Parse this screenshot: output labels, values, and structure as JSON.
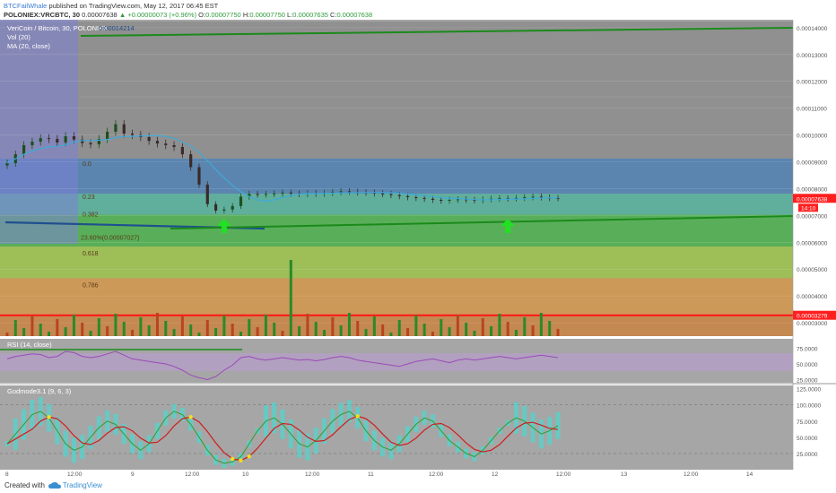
{
  "header": {
    "author": "BTCFailWhale",
    "published": "published on TradingView.com, May 12, 2017 06:45 EST",
    "symbol": "POLONIEX:VRCBTC, 30",
    "last": "0.00007638",
    "change": "▲ +0.00000073 (+0.96%)",
    "o_label": "O:",
    "o_value": "0.00007750",
    "h_label": "H:",
    "h_value": "0.00007750",
    "l_label": "L:",
    "l_value": "0.00007635",
    "c_label": "C:",
    "c_value": "0.00007638"
  },
  "footer": {
    "created_with": "Created with",
    "brand": "TradingView"
  },
  "colors": {
    "price_box": "#ff1f1f",
    "support_line": "#1b8a1b",
    "arrow": "#22e022",
    "rsi_line": "#9b4ab8",
    "godmode_red": "#cc1f1f",
    "godmode_green": "#2f9e2f",
    "godmode_cyan": "#4dd8d0",
    "godmode_yellow": "#f0e020"
  },
  "chart_data": [
    {
      "type": "candlestick",
      "legend": [
        "VeriCoin / Bitcoin, 30, POLONIEX",
        "Vol (20)",
        "MA (20, close)"
      ],
      "series_label": "0.00014214",
      "y_axis": [
        "0.00014000",
        "0.00013000",
        "0.00012000",
        "0.00011000",
        "0.00010000",
        "0.00009000",
        "0.00008000",
        "0.00007000",
        "0.00006000",
        "0.00005000",
        "0.00004000",
        "0.00003000"
      ],
      "ylim": [
        2.5e-05,
        0.0001423
      ],
      "current_price": {
        "value": "0.00007638",
        "time_left": "14:10"
      },
      "support_level": {
        "value": "0.00003279",
        "y": 3.279e-05
      },
      "fib_labels": [
        "0.0",
        "0.23",
        "0.382",
        "23.60%(0.00007027)",
        "0.618",
        "0.786"
      ],
      "fib_levels_price": [
        0.0001423,
        9.12e-05,
        7.81e-05,
        7.027e-05,
        5.84e-05,
        4.66e-05,
        3.279e-05
      ],
      "x_labels": [
        "8",
        "12:00",
        "9",
        "12:00",
        "10",
        "12:00",
        "11",
        "12:00",
        "12",
        "12:00",
        "13",
        "12:00",
        "14"
      ],
      "price_close": [
        8.95e-05,
        9.28e-05,
        9.62e-05,
        9.75e-05,
        9.88e-05,
        9.85e-05,
        9.72e-05,
        9.95e-05,
        9.83e-05,
        9.7e-05,
        9.65e-05,
        9.85e-05,
        0.0001012,
        0.000104,
        0.0001005,
        0.0001,
        9.92e-05,
        9.78e-05,
        9.68e-05,
        9.62e-05,
        9.55e-05,
        9.28e-05,
        8.8e-05,
        8.15e-05,
        7.42e-05,
        7.18e-05,
        7.22e-05,
        7.35e-05,
        7.7e-05,
        7.8e-05,
        7.78e-05,
        7.8e-05,
        7.82e-05,
        7.85e-05,
        7.82e-05,
        7.8e-05,
        7.83e-05,
        7.81e-05,
        7.84e-05,
        7.87e-05,
        7.9e-05,
        7.88e-05,
        7.86e-05,
        7.85e-05,
        7.82e-05,
        7.8e-05,
        7.76e-05,
        7.72e-05,
        7.68e-05,
        7.65e-05,
        7.62e-05,
        7.58e-05,
        7.55e-05,
        7.58e-05,
        7.6e-05,
        7.58e-05,
        7.56e-05,
        7.6e-05,
        7.62e-05,
        7.64e-05,
        7.63e-05,
        7.65e-05,
        7.68e-05,
        7.7e-05,
        7.67e-05,
        7.65e-05,
        7.64e-05
      ],
      "volume_spike_index": 34,
      "arrows_at_index": [
        26,
        60
      ]
    },
    {
      "type": "line",
      "title": "RSI (14, close)",
      "y_axis": [
        "75.0000",
        "50.0000",
        "25.0000"
      ],
      "ylim": [
        20,
        90
      ],
      "values": [
        58,
        62,
        64,
        66,
        65,
        60,
        62,
        70,
        68,
        62,
        60,
        62,
        66,
        70,
        64,
        58,
        56,
        54,
        52,
        50,
        46,
        40,
        32,
        28,
        25,
        30,
        40,
        48,
        60,
        62,
        58,
        56,
        58,
        60,
        58,
        56,
        57,
        55,
        57,
        60,
        62,
        60,
        56,
        54,
        52,
        50,
        48,
        46,
        50,
        54,
        56,
        58,
        55,
        52,
        56,
        58,
        56,
        58,
        60,
        62,
        60,
        58,
        60,
        62,
        64,
        62,
        60
      ]
    },
    {
      "type": "line",
      "title": "Godmode3.1 (9, 6, 3)",
      "y_axis": [
        "125.0000",
        "100.0000",
        "75.0000",
        "50.0000",
        "25.0000"
      ],
      "ylim": [
        0,
        130
      ],
      "series": [
        {
          "name": "Godmode3.1 (9, 6, 3)",
          "values": [
            40,
            55,
            70,
            85,
            90,
            80,
            60,
            40,
            30,
            35,
            50,
            65,
            75,
            70,
            55,
            40,
            30,
            40,
            60,
            80,
            90,
            85,
            70,
            50,
            30,
            15,
            10,
            12,
            20,
            40,
            60,
            75,
            80,
            70,
            55,
            40,
            35,
            45,
            60,
            75,
            85,
            90,
            80,
            60,
            45,
            35,
            30,
            40,
            55,
            70,
            80,
            75,
            60,
            45,
            35,
            25,
            20,
            30,
            45,
            60,
            72,
            80,
            75,
            65,
            55,
            60,
            68
          ]
        }
      ]
    }
  ]
}
